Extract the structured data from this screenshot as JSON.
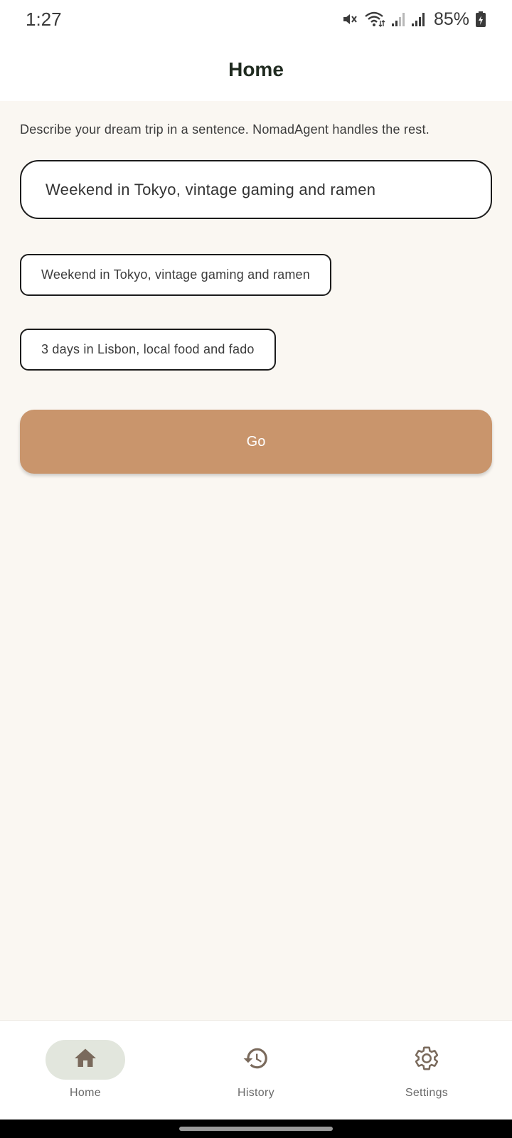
{
  "status_bar": {
    "time": "1:27",
    "battery": "85%",
    "icons": [
      "mute-icon",
      "wifi-icon",
      "signal-1-icon",
      "signal-2-icon",
      "battery-charging-icon"
    ]
  },
  "app_bar": {
    "title": "Home"
  },
  "main": {
    "subtitle": "Describe your dream trip in a sentence. NomadAgent handles the rest.",
    "trip_input": {
      "value": "Weekend in Tokyo, vintage gaming and ramen"
    },
    "suggestions": [
      {
        "label": "Weekend in Tokyo, vintage gaming and ramen"
      },
      {
        "label": "3 days in Lisbon, local food and fado"
      }
    ],
    "go_label": "Go"
  },
  "bottom_nav": {
    "items": [
      {
        "label": "Home",
        "icon": "home-icon",
        "active": true
      },
      {
        "label": "History",
        "icon": "history-icon",
        "active": false
      },
      {
        "label": "Settings",
        "icon": "gear-icon",
        "active": false
      }
    ]
  },
  "colors": {
    "background": "#faf7f2",
    "accent": "#c9956c",
    "active_nav_pill": "#e2e6dd",
    "nav_icon": "#7a6a5c"
  }
}
